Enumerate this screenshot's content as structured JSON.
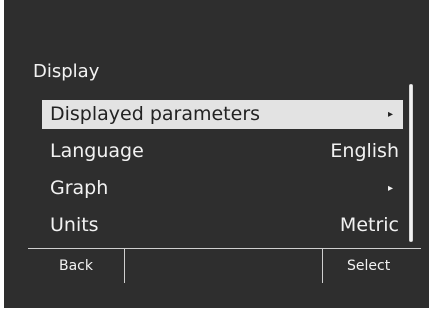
{
  "menu": {
    "title": "Display",
    "items": [
      {
        "label": "Displayed parameters",
        "value": "",
        "has_submenu": true,
        "selected": true
      },
      {
        "label": "Language",
        "value": "English",
        "has_submenu": false,
        "selected": false
      },
      {
        "label": "Graph",
        "value": "",
        "has_submenu": true,
        "selected": false
      },
      {
        "label": "Units",
        "value": "Metric",
        "has_submenu": false,
        "selected": false
      }
    ],
    "submenu_icon": "chevron-right-icon",
    "submenu_glyph": "▸"
  },
  "softkeys": {
    "left": "Back",
    "middle": "",
    "right": "Select"
  },
  "colors": {
    "screen_background": "#2e2e2e",
    "text": "#f2f2f2",
    "selected_background": "#e3e3e3",
    "selected_text": "#222222"
  }
}
